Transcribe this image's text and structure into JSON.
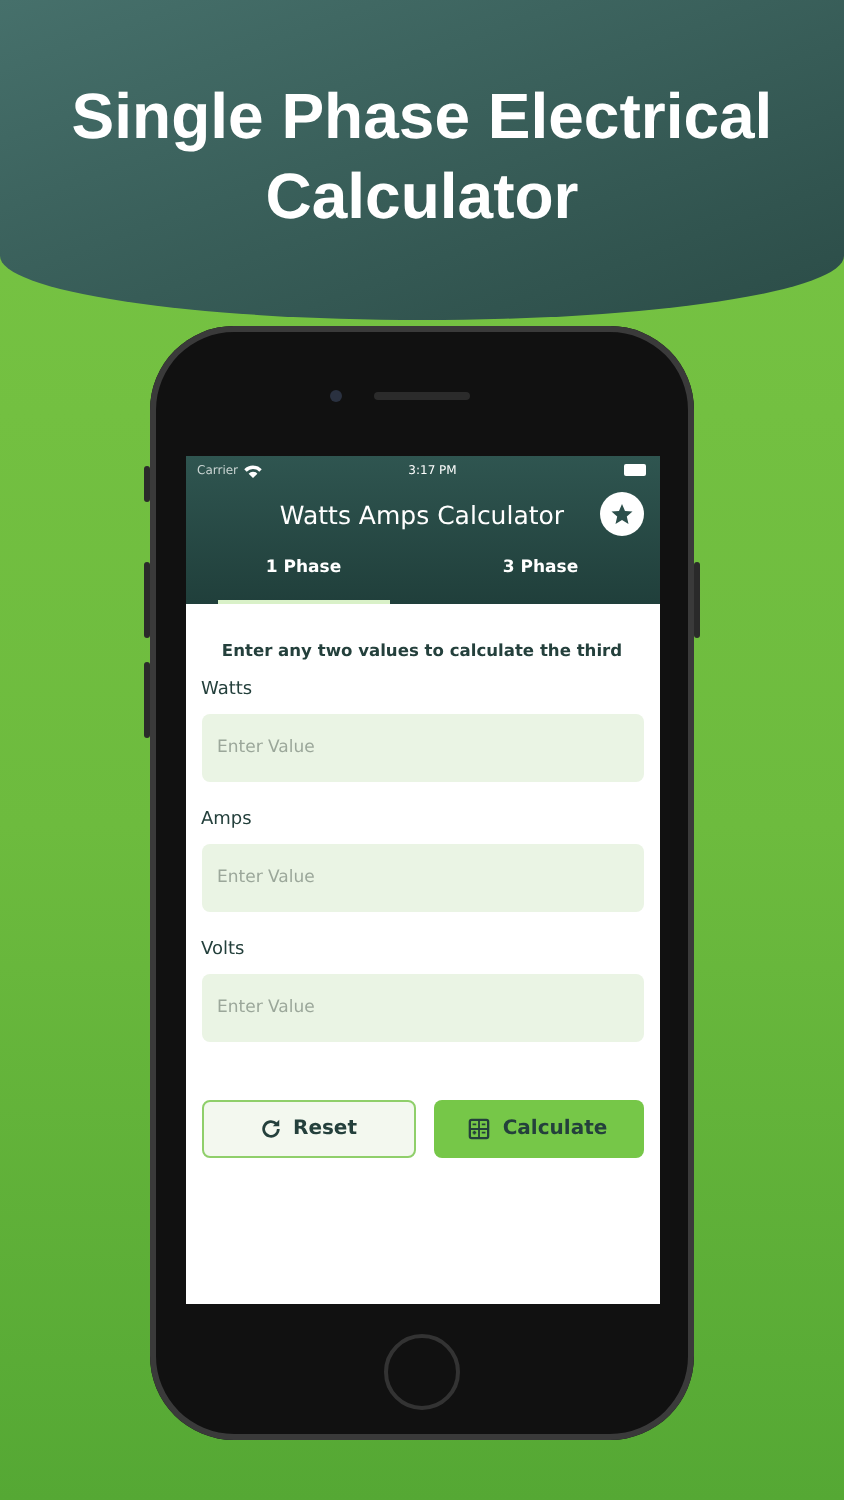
{
  "headline": "Single Phase Electrical Calculator",
  "status_bar": {
    "carrier": "Carrier",
    "time": "3:17 PM"
  },
  "header": {
    "title": "Watts Amps Calculator"
  },
  "tabs": [
    {
      "label": "1 Phase",
      "selected": true
    },
    {
      "label": "3 Phase",
      "selected": false
    }
  ],
  "instruction": "Enter any two values to calculate the third",
  "fields": [
    {
      "label": "Watts",
      "placeholder": "Enter Value"
    },
    {
      "label": "Amps",
      "placeholder": "Enter Value"
    },
    {
      "label": "Volts",
      "placeholder": "Enter Value"
    }
  ],
  "buttons": [
    {
      "label": "Reset",
      "kind": "reset"
    },
    {
      "label": "Calculate",
      "kind": "calculate"
    }
  ]
}
